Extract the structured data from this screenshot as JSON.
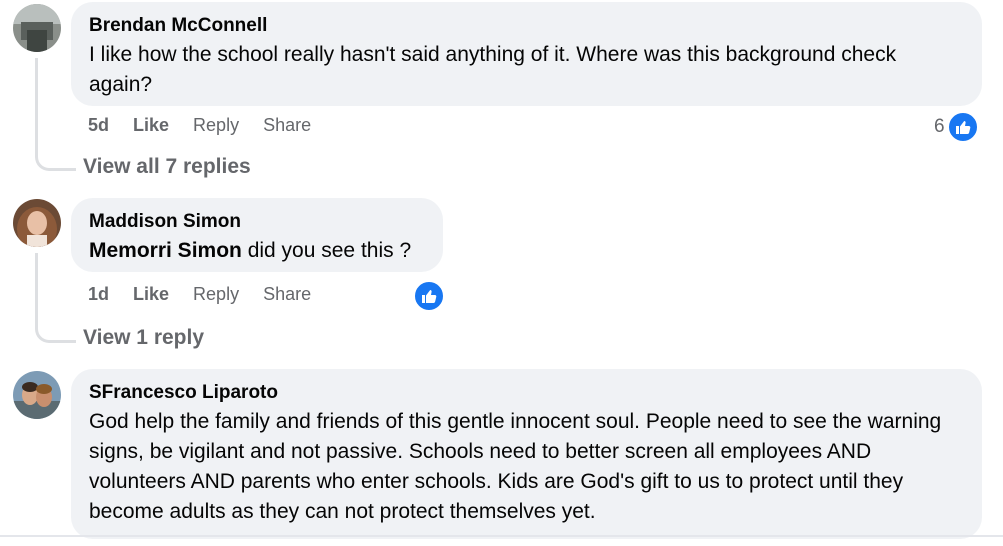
{
  "comments": [
    {
      "author": "Brendan McConnell",
      "text": "I like how the school really hasn't said anything of it. Where was this background check again?",
      "time": "5d",
      "like": "Like",
      "reply": "Reply",
      "share": "Share",
      "reaction_count": "6",
      "view_replies": "View all 7 replies"
    },
    {
      "author": "Maddison Simon",
      "mention": "Memorri Simon",
      "text": "did you see this ?",
      "time": "1d",
      "like": "Like",
      "reply": "Reply",
      "share": "Share",
      "view_replies": "View 1 reply"
    },
    {
      "author": "SFrancesco Liparoto",
      "text": "God help the family and friends of this gentle innocent soul. People need to see the warning signs, be vigilant and not passive. Schools need to better screen all employees AND volunteers AND parents who enter schools. Kids are God's gift to us to protect until they become adults as they can not protect themselves yet."
    }
  ],
  "colors": {
    "bubble": "#f0f2f5",
    "secondary_text": "#65676b",
    "like_blue": "#1877f2"
  },
  "icons": [
    "thumbs-up-icon"
  ]
}
